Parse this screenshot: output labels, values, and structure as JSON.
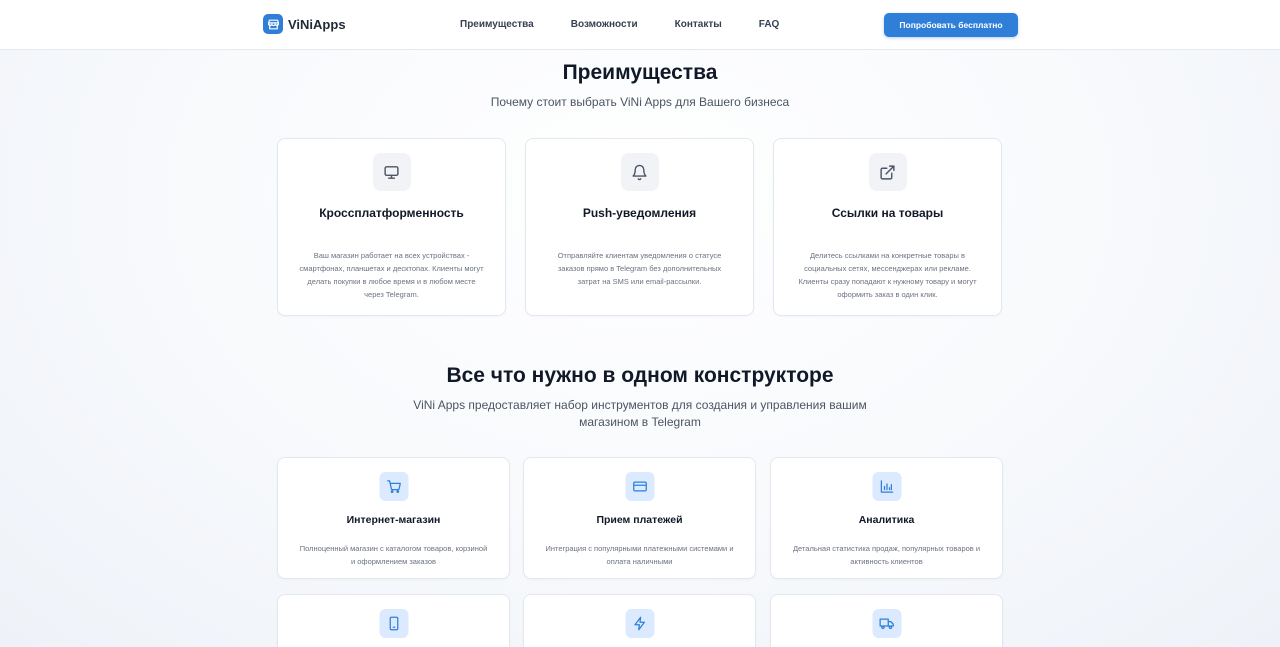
{
  "header": {
    "brand": "ViNiApps",
    "nav": [
      "Преимущества",
      "Возможности",
      "Контакты",
      "FAQ"
    ],
    "cta": "Попробовать бесплатно"
  },
  "advantages": {
    "title": "Преимущества",
    "subtitle": "Почему стоит выбрать ViNi Apps для Вашего бизнеса",
    "cards": [
      {
        "icon": "monitor-icon",
        "title": "Кроссплатформенность",
        "desc": "Ваш магазин работает на всех устройствах - смартфонах, планшетах и десктопах. Клиенты могут делать покупки в любое время и в любом месте через Telegram."
      },
      {
        "icon": "bell-icon",
        "title": "Push-уведомления",
        "desc": "Отправляйте клиентам уведомления о статусе заказов прямо в Telegram без дополнительных затрат на SMS или email-рассылки."
      },
      {
        "icon": "external-link-icon",
        "title": "Ссылки на товары",
        "desc": "Делитесь ссылками на конкретные товары в социальных сетях, мессенджерах или рекламе. Клиенты сразу попадают к нужному товару и могут оформить заказ в один клик."
      }
    ]
  },
  "features": {
    "title": "Все что нужно в одном конструкторе",
    "subtitle_line1": "ViNi Apps предоставляет набор инструментов для создания и управления вашим",
    "subtitle_line2": "магазином в Telegram",
    "cards": [
      {
        "icon": "shopping-cart-icon",
        "title": "Интернет-магазин",
        "desc": "Полноценный магазин с каталогом товаров, корзиной и оформлением заказов"
      },
      {
        "icon": "credit-card-icon",
        "title": "Прием платежей",
        "desc": "Интеграция с популярными платежными системами и оплата наличными"
      },
      {
        "icon": "bar-chart-icon",
        "title": "Аналитика",
        "desc": "Детальная статистика продаж, популярных товаров и активность клиентов"
      },
      {
        "icon": "smartphone-icon",
        "title": "",
        "desc": ""
      },
      {
        "icon": "lightning-icon",
        "title": "",
        "desc": ""
      },
      {
        "icon": "truck-icon",
        "title": "",
        "desc": ""
      }
    ]
  },
  "colors": {
    "accent": "#2f7fd8",
    "icon_bg_blue": "#dbeafe",
    "icon_bg_gray": "#f1f3f6"
  }
}
